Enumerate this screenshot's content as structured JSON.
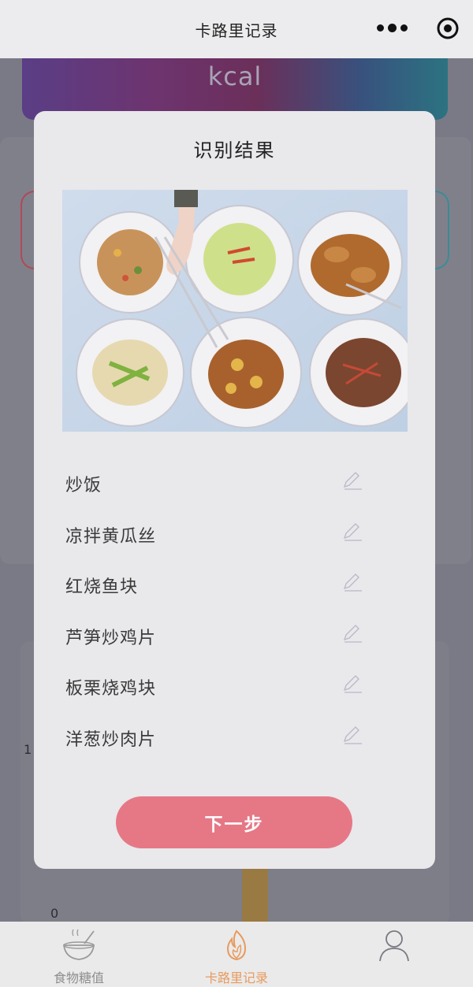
{
  "header": {
    "title": "卡路里记录"
  },
  "background": {
    "kcal_label": "kcal",
    "axis_one": "1",
    "axis_zero": "0"
  },
  "modal": {
    "title": "识别结果",
    "foods": [
      "炒饭",
      "凉拌黄瓜丝",
      "红烧鱼块",
      "芦笋炒鸡片",
      "板栗烧鸡块",
      "洋葱炒肉片"
    ],
    "next_label": "下一步"
  },
  "tabbar": {
    "tabs": [
      {
        "label": "食物糖值",
        "icon": "rice-bowl-icon"
      },
      {
        "label": "卡路里记录",
        "icon": "flame-icon",
        "active": true
      },
      {
        "label": "",
        "icon": "user-icon"
      }
    ]
  },
  "colors": {
    "accent_button": "#e67886",
    "active_tab": "#e89a5e",
    "overlay": "#7a7a86"
  }
}
